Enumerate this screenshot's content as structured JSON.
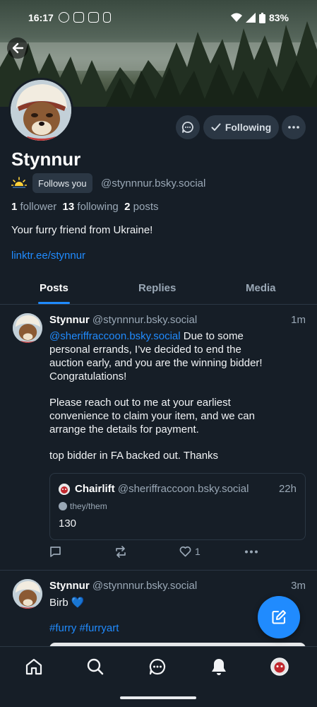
{
  "status_bar": {
    "time": "16:17",
    "battery": "83%"
  },
  "profile": {
    "display_name": "Stynnur",
    "follows_you_badge": "Follows you",
    "handle": "@stynnnur.bsky.social",
    "followers_count": "1",
    "followers_label": "follower",
    "following_count": "13",
    "following_label": "following",
    "posts_count": "2",
    "posts_label": "posts",
    "bio": "Your furry friend from Ukraine!",
    "link": "linktr.ee/stynnur",
    "follow_button_label": "Following"
  },
  "tabs": [
    {
      "label": "Posts",
      "active": true
    },
    {
      "label": "Replies",
      "active": false
    },
    {
      "label": "Media",
      "active": false
    }
  ],
  "posts": [
    {
      "author": "Stynnur",
      "handle": "@stynnnur.bsky.social",
      "time": "1m",
      "mention": "@sheriffraccoon.bsky.social",
      "line1_rest": " Due to some",
      "line2": "personal errands, I’ve decided to end the",
      "line3": "auction early, and you are the winning bidder!",
      "line4": "Congratulations!",
      "para2_line1": "Please reach out to me at your earliest",
      "para2_line2": "convenience to claim your item, and we can",
      "para2_line3": "arrange the details for payment.",
      "para3": "top bidder in FA backed out. Thanks",
      "quote": {
        "author": "Chairlift",
        "handle": "@sheriffraccoon.bsky.social",
        "time": "22h",
        "pronouns": "they/them",
        "text": "130"
      },
      "like_count": "1"
    },
    {
      "author": "Stynnur",
      "handle": "@stynnnur.bsky.social",
      "time": "3m",
      "text": "Birb 💙",
      "hashtags": "#furry #furryart"
    }
  ],
  "colors": {
    "accent": "#208bfe",
    "background": "#161e27",
    "surface": "#2b3744",
    "muted_text": "#9aa8b6"
  }
}
